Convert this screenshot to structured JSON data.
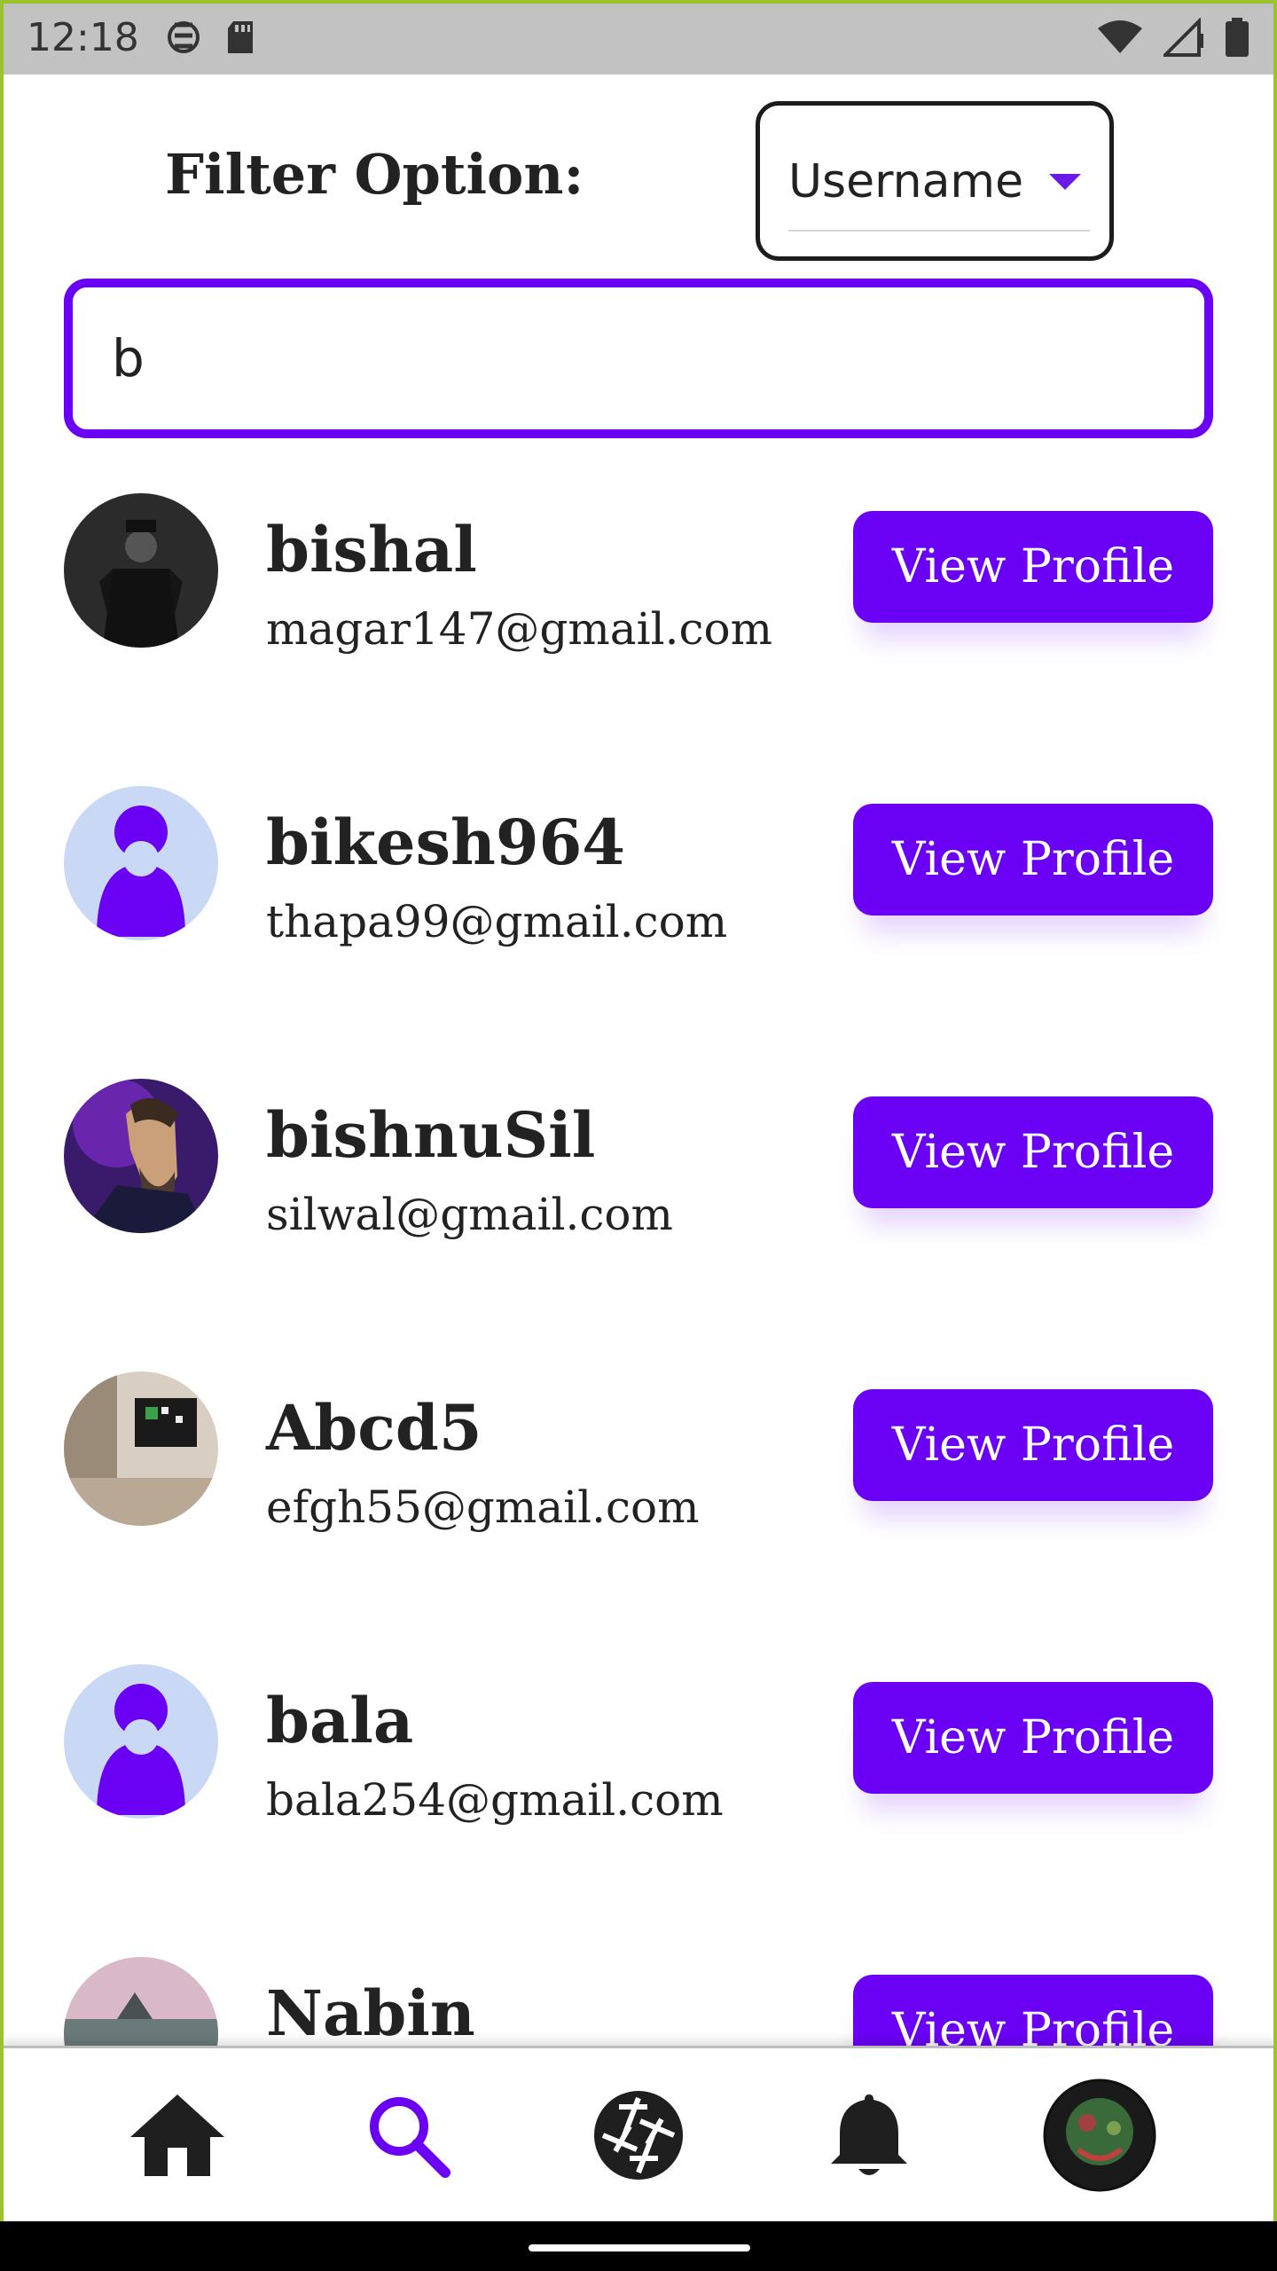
{
  "status_bar": {
    "time": "12:18"
  },
  "filter": {
    "label": "Filter Option:",
    "selected": "Username"
  },
  "search": {
    "value": "b"
  },
  "users": [
    {
      "username": "bishal",
      "email": "magar147@gmail.com",
      "avatar": "photo-dark-figure",
      "button": "View Profile"
    },
    {
      "username": "bikesh964",
      "email": "thapa99@gmail.com",
      "avatar": "default-user-icon",
      "button": "View Profile"
    },
    {
      "username": "bishnuSil",
      "email": "silwal@gmail.com",
      "avatar": "photo-portrait-purple",
      "button": "View Profile"
    },
    {
      "username": "Abcd5",
      "email": "efgh55@gmail.com",
      "avatar": "photo-room-interior",
      "button": "View Profile"
    },
    {
      "username": "bala",
      "email": "bala254@gmail.com",
      "avatar": "default-user-icon",
      "button": "View Profile"
    },
    {
      "username": "Nabin",
      "email": "",
      "avatar": "photo-seascape",
      "button": "View Profile"
    }
  ],
  "nav": {
    "active": "search",
    "items": [
      "home-icon",
      "search-icon",
      "camera-aperture-icon",
      "bell-icon",
      "profile-avatar"
    ]
  },
  "colors": {
    "accent": "#6a00f4",
    "avatar_bg": "#c9d8f5",
    "status_bar": "#c2c2c2"
  }
}
